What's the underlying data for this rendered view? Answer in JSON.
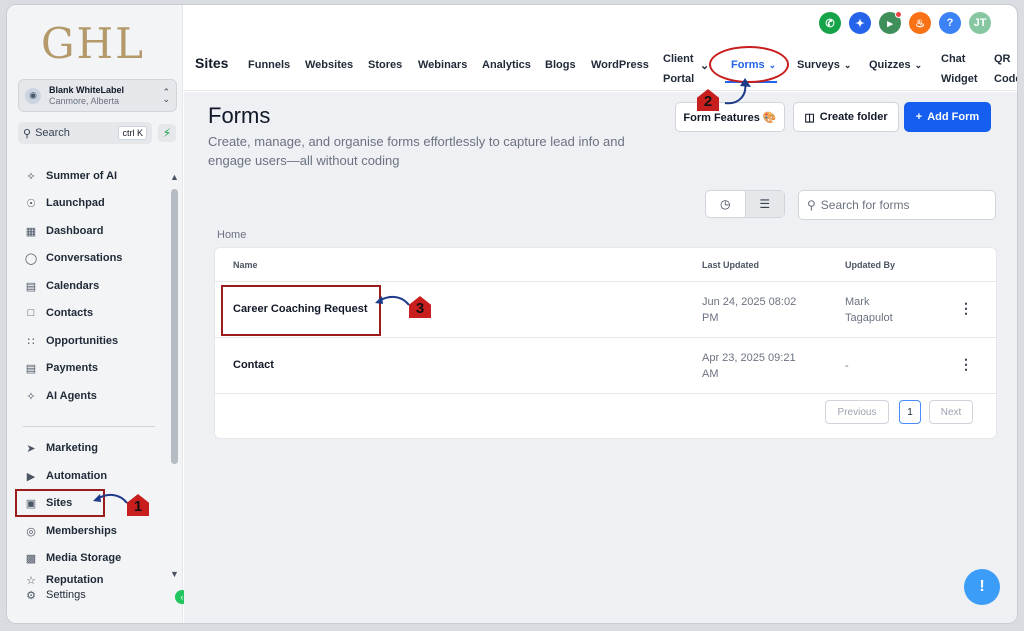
{
  "brand": {
    "logo": "GHL"
  },
  "account": {
    "name": "Blank WhiteLabel",
    "location": "Canmore, Alberta"
  },
  "sidebar": {
    "search_label": "Search",
    "search_shortcut": "ctrl K",
    "items": [
      {
        "label": "Summer of AI",
        "icon": "sparkle-icon"
      },
      {
        "label": "Launchpad",
        "icon": "rocket-icon"
      },
      {
        "label": "Dashboard",
        "icon": "grid-icon"
      },
      {
        "label": "Conversations",
        "icon": "chat-icon"
      },
      {
        "label": "Calendars",
        "icon": "calendar-icon"
      },
      {
        "label": "Contacts",
        "icon": "contacts-icon"
      },
      {
        "label": "Opportunities",
        "icon": "opportunities-icon"
      },
      {
        "label": "Payments",
        "icon": "payments-icon"
      },
      {
        "label": "AI Agents",
        "icon": "sparkle-icon"
      },
      {
        "label": "Marketing",
        "icon": "send-icon"
      },
      {
        "label": "Automation",
        "icon": "automation-icon"
      },
      {
        "label": "Sites",
        "icon": "sites-icon"
      },
      {
        "label": "Memberships",
        "icon": "award-icon"
      },
      {
        "label": "Media Storage",
        "icon": "image-icon"
      },
      {
        "label": "Reputation",
        "icon": "star-icon"
      },
      {
        "label": "Settings",
        "icon": "gear-icon"
      }
    ]
  },
  "header_icons": {
    "phone_color": "#16a34a",
    "tools_color": "#2563eb",
    "megaphone_color": "#3f8f5a",
    "bell_color": "#f97316",
    "help_color": "#3b82f6",
    "avatar_color": "#86c7a2",
    "avatar_initials": "JT"
  },
  "topnav": {
    "title": "Sites",
    "tabs": {
      "funnels": "Funnels",
      "websites": "Websites",
      "stores": "Stores",
      "webinars": "Webinars",
      "analytics": "Analytics",
      "blogs": "Blogs",
      "wordpress": "WordPress",
      "client_portal_1": "Client",
      "client_portal_2": "Portal",
      "forms": "Forms",
      "surveys": "Surveys",
      "quizzes": "Quizzes",
      "chat_widget_1": "Chat",
      "chat_widget_2": "Widget",
      "qr_code_1": "QR",
      "qr_code_2": "Code"
    }
  },
  "page": {
    "title": "Forms",
    "description": "Create, manage, and organise forms effortlessly to capture lead info and engage users—all without coding",
    "buttons": {
      "form_features": "Form Features 🎨",
      "create_folder": "Create folder",
      "add_form": "Add Form"
    },
    "search_placeholder": "Search for forms",
    "breadcrumb": "Home"
  },
  "table": {
    "columns": {
      "name": "Name",
      "last_updated": "Last Updated",
      "updated_by": "Updated By"
    },
    "rows": [
      {
        "name": "Career Coaching Request",
        "date_line1": "Jun 24, 2025 08:02",
        "date_line2": "PM",
        "by_line1": "Mark",
        "by_line2": "Tagapulot"
      },
      {
        "name": "Contact",
        "date_line1": "Apr 23, 2025 09:21",
        "date_line2": "AM",
        "by_line1": "-",
        "by_line2": ""
      }
    ],
    "pagination": {
      "previous": "Previous",
      "page": "1",
      "next": "Next"
    }
  },
  "annotations": {
    "step1": "1",
    "step2": "2",
    "step3": "3"
  }
}
